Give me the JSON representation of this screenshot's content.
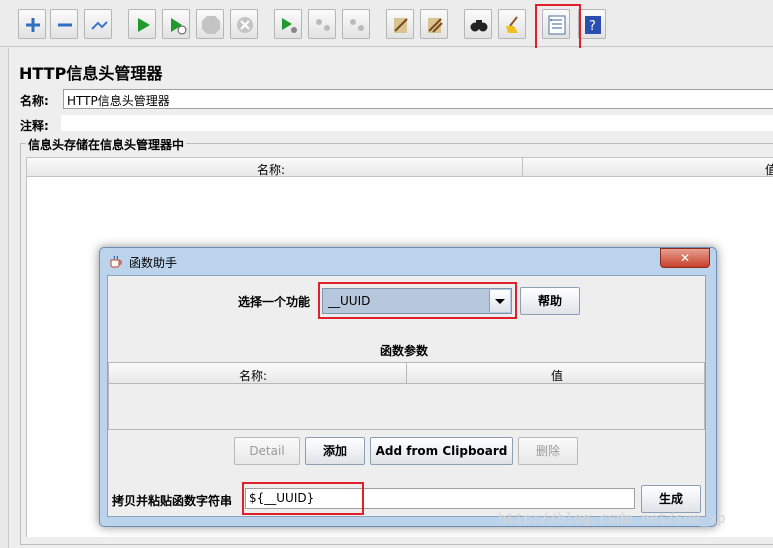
{
  "toolbar": {
    "icons": [
      "add-icon",
      "remove-icon",
      "clear-icon",
      "start-icon",
      "start-no-timers-icon",
      "stop-icon",
      "shutdown-icon",
      "remote-start-icon",
      "remote-stop-icon",
      "remote-shutdown-icon",
      "clear-all-icon",
      "clear-results-icon",
      "search-icon",
      "reset-search-icon",
      "function-helper-icon",
      "help-icon"
    ]
  },
  "panel": {
    "title": "HTTP信息头管理器",
    "name_label": "名称:",
    "name_value": "HTTP信息头管理器",
    "comment_label": "注释:",
    "comment_value": "",
    "group_title": "信息头存储在信息头管理器中",
    "col_name": "名称:",
    "col_value": "值"
  },
  "dialog": {
    "title": "函数助手",
    "close_symbol": "✕",
    "select_label": "选择一个功能",
    "selected_function": "__UUID",
    "help_button": "帮助",
    "params_title": "函数参数",
    "param_col_name": "名称:",
    "param_col_value": "值",
    "detail_button": "Detail",
    "add_button": "添加",
    "add_clipboard_button": "Add from Clipboard",
    "delete_button": "删除",
    "copy_label": "拷贝并粘贴函数字符串",
    "function_string": "${__UUID}",
    "generate_button": "生成"
  },
  "watermark": "http://blog.csdn.net/sue_xp",
  "colors": {
    "highlight": "#e0202a",
    "accent": "#1a73c8"
  }
}
